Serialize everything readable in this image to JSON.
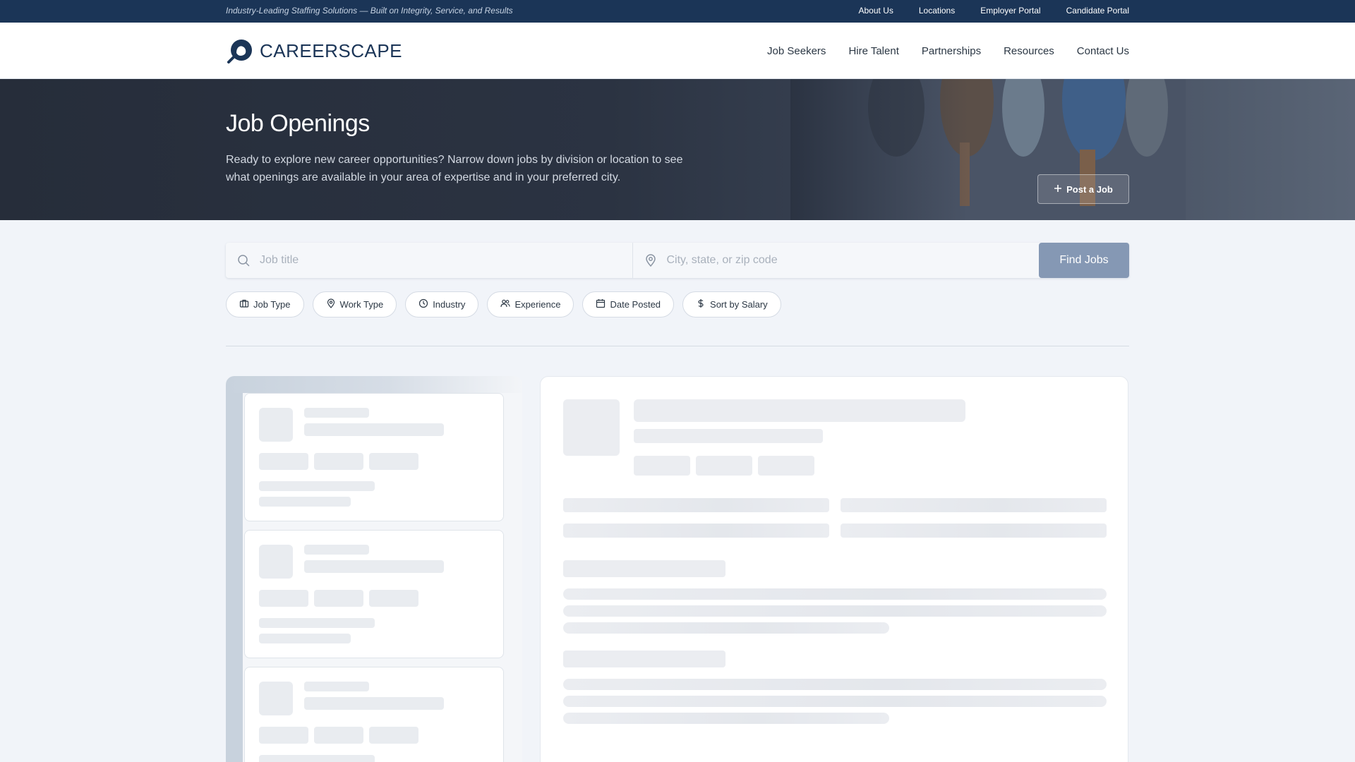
{
  "topbar": {
    "tagline": "Industry-Leading Staffing Solutions — Built on Integrity, Service, and Results",
    "links": [
      "About Us",
      "Locations",
      "Employer Portal",
      "Candidate Portal"
    ]
  },
  "header": {
    "brand": "CAREERSCAPE",
    "nav": [
      "Job Seekers",
      "Hire Talent",
      "Partnerships",
      "Resources",
      "Contact Us"
    ]
  },
  "hero": {
    "title": "Job Openings",
    "description": "Ready to explore new career opportunities? Narrow down jobs by division or location to see what openings are available in your area of expertise and in your preferred city.",
    "post_button": "Post a Job"
  },
  "search": {
    "job_placeholder": "Job title",
    "location_placeholder": "City, state, or zip code",
    "find_button": "Find Jobs"
  },
  "filters": [
    {
      "label": "Job Type",
      "icon": "briefcase-icon"
    },
    {
      "label": "Work Type",
      "icon": "map-pin-icon"
    },
    {
      "label": "Industry",
      "icon": "clock-icon"
    },
    {
      "label": "Experience",
      "icon": "users-icon"
    },
    {
      "label": "Date Posted",
      "icon": "calendar-icon"
    },
    {
      "label": "Sort by Salary",
      "icon": "dollar-icon"
    }
  ],
  "colors": {
    "topbar": "#1b3557",
    "brand": "#1b3557",
    "find_button": "#8598b4",
    "page_bg": "#f1f4f9"
  }
}
